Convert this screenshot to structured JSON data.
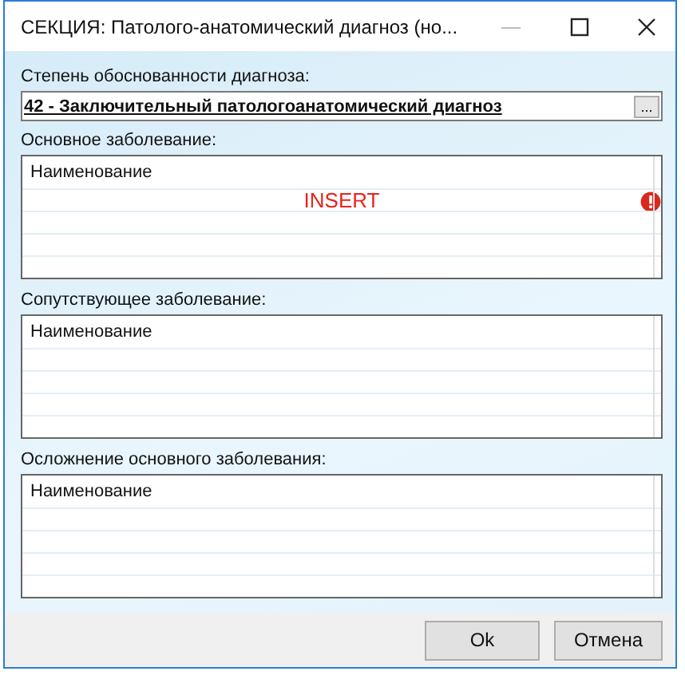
{
  "window": {
    "title": "СЕКЦИЯ: Патолого-анатомический диагноз (но..."
  },
  "diagnosis": {
    "label": "Степень обоснованности диагноза:",
    "value": "42 - Заключительный патологоанатомический диагноз",
    "browse": "..."
  },
  "sections": [
    {
      "label": "Основное заболевание:",
      "column": "Наименование",
      "placeholder": "INSERT",
      "error": true
    },
    {
      "label": "Сопутствующее заболевание:",
      "column": "Наименование",
      "error": false
    },
    {
      "label": "Осложнение основного заболевания:",
      "column": "Наименование",
      "error": false
    }
  ],
  "buttons": [
    "Ok",
    "Отмена"
  ]
}
